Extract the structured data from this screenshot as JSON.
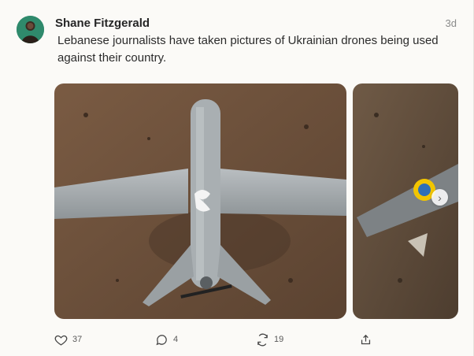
{
  "post": {
    "author": "Shane Fitzgerald",
    "time": "3d",
    "text": "Lebanese journalists have taken pictures of Ukrainian drones being used against their country."
  },
  "media": [
    {
      "name": "drone-photo-1"
    },
    {
      "name": "drone-photo-2"
    }
  ],
  "actions": {
    "likes": "37",
    "comments": "4",
    "reposts": "19"
  },
  "icons": {
    "like": "heart-icon",
    "comment": "comment-icon",
    "repost": "repost-icon",
    "share": "share-icon",
    "next": "chevron-right-icon"
  }
}
